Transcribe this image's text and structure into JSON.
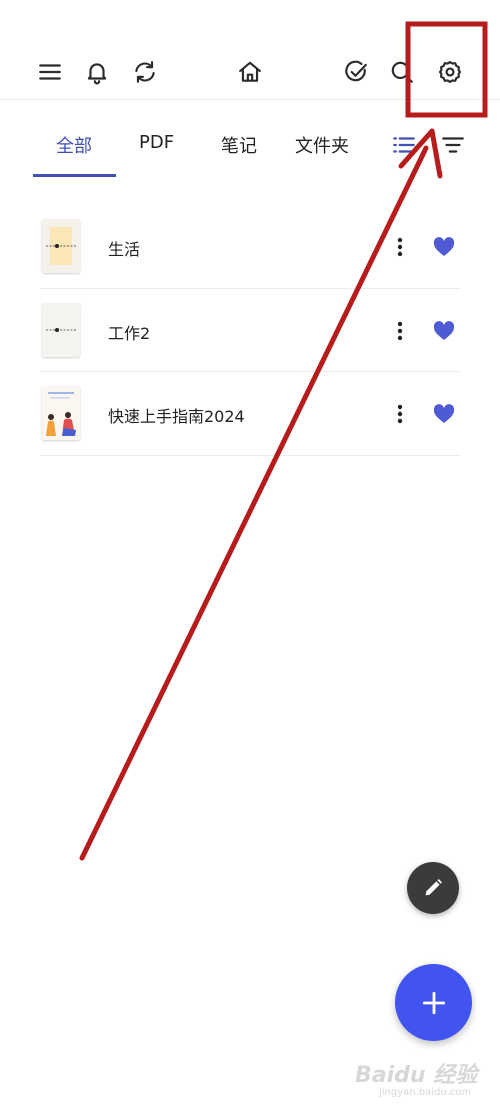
{
  "toolbar": {
    "icons": [
      "menu-icon",
      "bell-icon",
      "sync-icon",
      "home-icon",
      "check-circle-icon",
      "search-icon",
      "gear-icon"
    ]
  },
  "tabs": {
    "items": [
      {
        "label": "全部",
        "active": true
      },
      {
        "label": "PDF",
        "active": false
      },
      {
        "label": "笔记",
        "active": false
      },
      {
        "label": "文件夹",
        "active": false
      }
    ],
    "icons": [
      "list-view-icon",
      "sort-icon"
    ]
  },
  "documents": [
    {
      "title": "生活",
      "favorite": true
    },
    {
      "title": "工作2",
      "favorite": true
    },
    {
      "title": "快速上手指南2024",
      "favorite": true
    }
  ],
  "fab": {
    "edit_icon": "pencil-icon",
    "add_icon": "plus-icon"
  },
  "colors": {
    "accent": "#3f51b5",
    "heart": "#4f5bd5",
    "fab_add": "#4254f0",
    "fab_edit": "#3b3b3b",
    "annotation": "#b71c1c"
  },
  "watermark": {
    "main": "Baidu 经验",
    "sub": "jingyan.baidu.com"
  }
}
